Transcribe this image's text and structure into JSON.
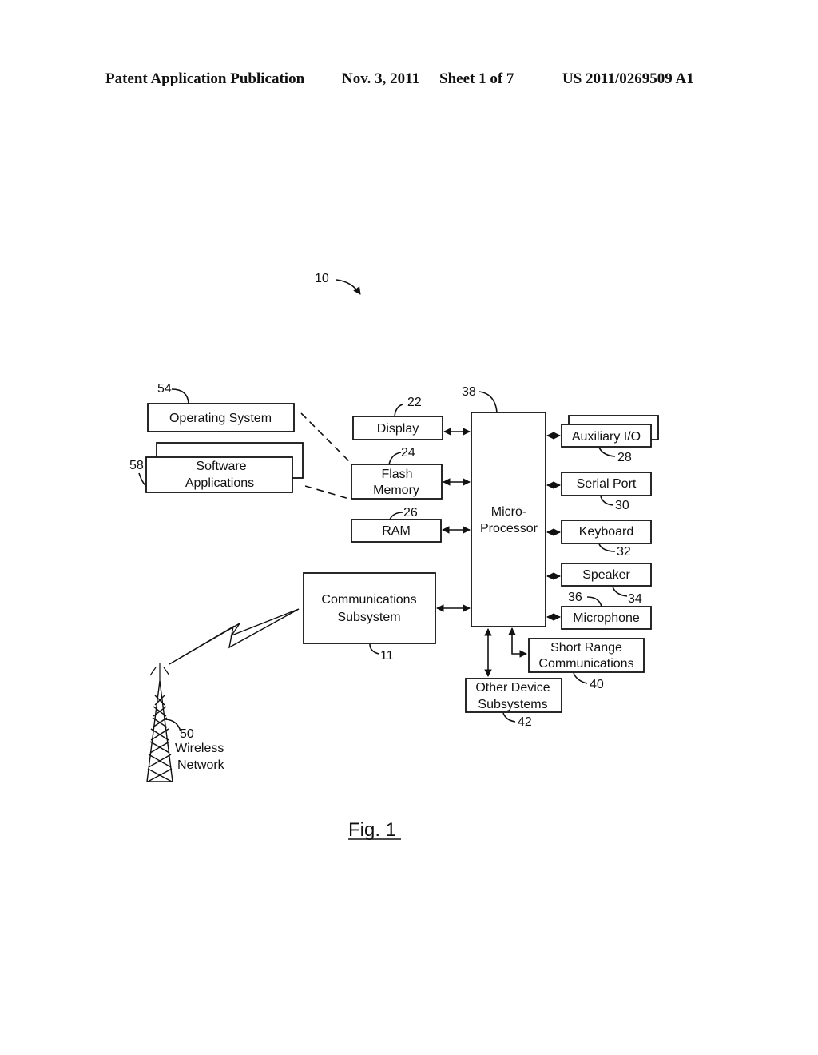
{
  "header": {
    "publication": "Patent Application Publication",
    "date": "Nov. 3, 2011",
    "sheet": "Sheet 1 of 7",
    "number": "US 2011/0269509 A1"
  },
  "figure": {
    "device_ref": "10",
    "caption": "Fig. 1",
    "blocks": {
      "operating_system": {
        "label": "Operating System",
        "ref": "54"
      },
      "software_applications": {
        "line1": "Software",
        "line2": "Applications",
        "ref": "58"
      },
      "display": {
        "label": "Display",
        "ref": "22"
      },
      "flash_memory": {
        "line1": "Flash",
        "line2": "Memory",
        "ref": "24"
      },
      "ram": {
        "label": "RAM",
        "ref": "26"
      },
      "microprocessor": {
        "line1": "Micro-",
        "line2": "Processor",
        "ref": "38"
      },
      "auxiliary_io": {
        "label": "Auxiliary I/O",
        "ref": "28"
      },
      "serial_port": {
        "label": "Serial Port",
        "ref": "30"
      },
      "keyboard": {
        "label": "Keyboard",
        "ref": "32"
      },
      "speaker": {
        "label": "Speaker",
        "ref": "34"
      },
      "microphone": {
        "label": "Microphone",
        "ref": "36"
      },
      "short_range": {
        "line1": "Short Range",
        "line2": "Communications",
        "ref": "40"
      },
      "other_device": {
        "line1": "Other Device",
        "line2": "Subsystems",
        "ref": "42"
      },
      "communications": {
        "line1": "Communications",
        "line2": "Subsystem",
        "ref": "11"
      },
      "wireless_network": {
        "ref": "50",
        "line1": "Wireless",
        "line2": "Network"
      }
    }
  }
}
